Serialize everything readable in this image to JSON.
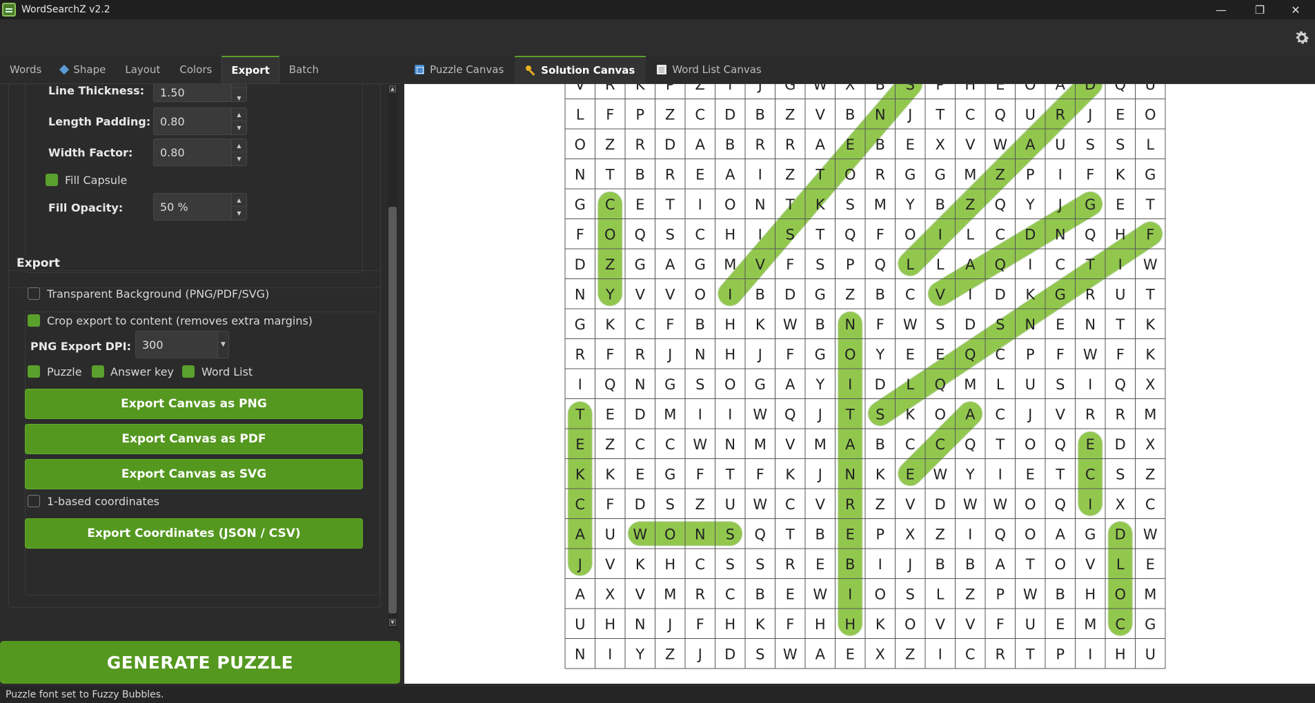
{
  "window": {
    "title": "WordSearchZ v2.2"
  },
  "left_tabs": [
    {
      "label": "Words"
    },
    {
      "label": "Shape"
    },
    {
      "label": "Layout"
    },
    {
      "label": "Colors"
    },
    {
      "label": "Export"
    },
    {
      "label": "Batch"
    }
  ],
  "form": {
    "line_thickness_label": "Line Thickness:",
    "line_thickness_value": "1.50",
    "length_padding_label": "Length Padding:",
    "length_padding_value": "0.80",
    "width_factor_label": "Width Factor:",
    "width_factor_value": "0.80",
    "fill_capsule_label": "Fill Capsule",
    "fill_capsule_checked": true,
    "fill_opacity_label": "Fill Opacity:",
    "fill_opacity_value": "50 %"
  },
  "export": {
    "section_title": "Export",
    "transparent_label": "Transparent Background (PNG/PDF/SVG)",
    "transparent_checked": false,
    "crop_label": "Crop export to content (removes extra margins)",
    "crop_checked": true,
    "dpi_label": "PNG Export DPI:",
    "dpi_value": "300",
    "puzzle_label": "Puzzle",
    "answer_key_label": "Answer key",
    "word_list_label": "Word List",
    "png_button": "Export Canvas as PNG",
    "pdf_button": "Export Canvas as PDF",
    "svg_button": "Export Canvas as SVG",
    "one_based_label": "1-based coordinates",
    "one_based_checked": false,
    "coords_button": "Export Coordinates (JSON / CSV)"
  },
  "generate_button": "GENERATE PUZZLE",
  "right_tabs": [
    {
      "label": "Puzzle Canvas"
    },
    {
      "label": "Solution Canvas"
    },
    {
      "label": "Word List Canvas"
    }
  ],
  "grid": {
    "rows": [
      "VRKPZIJGWXBSPHEOADQU",
      "LFPZCDBZVBNJTCQURJEO",
      "OZRDABRRAEBEXVWAUSSL",
      "NTBREAIZTORGGMZPIFKG",
      "GCETIONTKSMYBZQYJGET",
      "FOQSCHISTQFOILCDNQHF",
      "DZGAGMVFSPQLLAQICTIW",
      "NYVVOIBDGZBCVIDKGRUT",
      "GKCFBHKWBNFWSDSNENTK",
      "RFRJNHJFGOYEEQCPFWFK",
      "IQNGSOGAYIDLQMLUSIQX",
      "TEDMIIWQJTSKOACJVRRM",
      "EZCCWNMVMABCCQTOQEDX",
      "KKEGFTFKJNKEWYIETCSZ",
      "CFDSZUWCVRZVDWWOQIXC",
      "AUWONSQTBEPXZIQOAGDW",
      "JVKHCSSREBIJBBATOVLE",
      "AXVMRCBEWIOSLZPWBHOM",
      "UHNJFHKFHHKOVVFUEMCG",
      "NIYZJDSWAEXZICRTPIHU"
    ],
    "highlights": [
      {
        "word": "SNETTIHM",
        "from": [
          0,
          11
        ],
        "to": [
          7,
          5
        ]
      },
      {
        "word": "DRAZZY",
        "from": [
          0,
          17
        ],
        "to": [
          6,
          11
        ]
      },
      {
        "word": "COZY",
        "from": [
          4,
          1
        ],
        "to": [
          7,
          1
        ]
      },
      {
        "word": "GNIRLB",
        "from": [
          4,
          17
        ],
        "to": [
          7,
          12
        ]
      },
      {
        "word": "FIRENPDLS",
        "from": [
          5,
          19
        ],
        "to": [
          11,
          10
        ]
      },
      {
        "word": "NOITANREBIH",
        "from": [
          8,
          9
        ],
        "to": [
          18,
          9
        ]
      },
      {
        "word": "TEKCAJ",
        "from": [
          11,
          0
        ],
        "to": [
          16,
          0
        ]
      },
      {
        "word": "ECI",
        "from": [
          12,
          17
        ],
        "to": [
          14,
          17
        ]
      },
      {
        "word": "WONS",
        "from": [
          15,
          2
        ],
        "to": [
          15,
          5
        ]
      },
      {
        "word": "DLOC",
        "from": [
          15,
          18
        ],
        "to": [
          18,
          18
        ]
      },
      {
        "word": "ECE",
        "from": [
          13,
          11
        ],
        "to": [
          11,
          13
        ]
      }
    ],
    "highlight_color": "#8cc63f",
    "highlight_opacity": 0.5
  },
  "status": "Puzzle font set to Fuzzy Bubbles.",
  "colors": {
    "accent": "#54981f",
    "background": "#2b2b2b"
  }
}
